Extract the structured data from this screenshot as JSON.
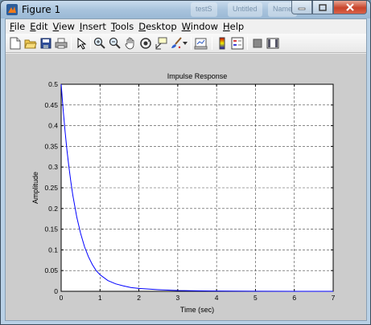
{
  "window": {
    "title": "Figure 1",
    "background_tabs": [
      "testS",
      "Untitled",
      "Name"
    ]
  },
  "menu": [
    {
      "label": "File",
      "mnemonic": "F",
      "rest": "ile"
    },
    {
      "label": "Edit",
      "mnemonic": "E",
      "rest": "dit"
    },
    {
      "label": "View",
      "mnemonic": "V",
      "rest": "iew"
    },
    {
      "label": "Insert",
      "mnemonic": "I",
      "rest": "nsert"
    },
    {
      "label": "Tools",
      "mnemonic": "T",
      "rest": "ools"
    },
    {
      "label": "Desktop",
      "mnemonic": "D",
      "rest": "esktop"
    },
    {
      "label": "Window",
      "mnemonic": "W",
      "rest": "indow"
    },
    {
      "label": "Help",
      "mnemonic": "H",
      "rest": "elp"
    }
  ],
  "toolbar": {
    "buttons": [
      "new-figure-icon",
      "open-file-icon",
      "save-icon",
      "print-icon",
      "select-arrow-icon",
      "zoom-in-icon",
      "zoom-out-icon",
      "pan-hand-icon",
      "rotate-3d-icon",
      "data-cursor-icon",
      "brush-icon",
      "brush-dropdown-icon",
      "link-plot-icon",
      "colorbar-icon",
      "legend-icon",
      "hide-plot-tools-icon",
      "show-plot-tools-icon"
    ]
  },
  "colors": {
    "line": "#0000ff",
    "figure_bg": "#cccccc",
    "axes_bg": "#ffffff",
    "grid": "#444444"
  },
  "chart_data": {
    "type": "line",
    "title": "Impulse Response",
    "xlabel": "Time (sec)",
    "ylabel": "Amplitude",
    "xlim": [
      0,
      7
    ],
    "ylim": [
      0,
      0.5
    ],
    "xticks": [
      0,
      1,
      2,
      3,
      4,
      5,
      6,
      7
    ],
    "yticks": [
      0,
      0.05,
      0.1,
      0.15,
      0.2,
      0.25,
      0.3,
      0.35,
      0.4,
      0.45,
      0.5
    ],
    "ytick_labels": [
      "0",
      "0.05",
      "0.1",
      "0.15",
      "0.2",
      "0.25",
      "0.3",
      "0.35",
      "0.4",
      "0.45",
      "0.5"
    ],
    "grid": true,
    "series": [
      {
        "x": [
          0,
          0.05,
          0.1,
          0.15,
          0.2,
          0.25,
          0.3,
          0.4,
          0.5,
          0.6,
          0.7,
          0.8,
          0.9,
          1.0,
          1.2,
          1.4,
          1.6,
          1.8,
          2.0,
          2.5,
          3.0,
          3.5,
          4.0,
          5.0,
          6.0,
          7.0
        ],
        "y": [
          0.5,
          0.44,
          0.387,
          0.34,
          0.3,
          0.264,
          0.232,
          0.18,
          0.14,
          0.108,
          0.084,
          0.065,
          0.05,
          0.04,
          0.026,
          0.018,
          0.013,
          0.009,
          0.007,
          0.004,
          0.002,
          0.0012,
          0.0008,
          0.0003,
          0.0001,
          0.0
        ]
      }
    ]
  }
}
